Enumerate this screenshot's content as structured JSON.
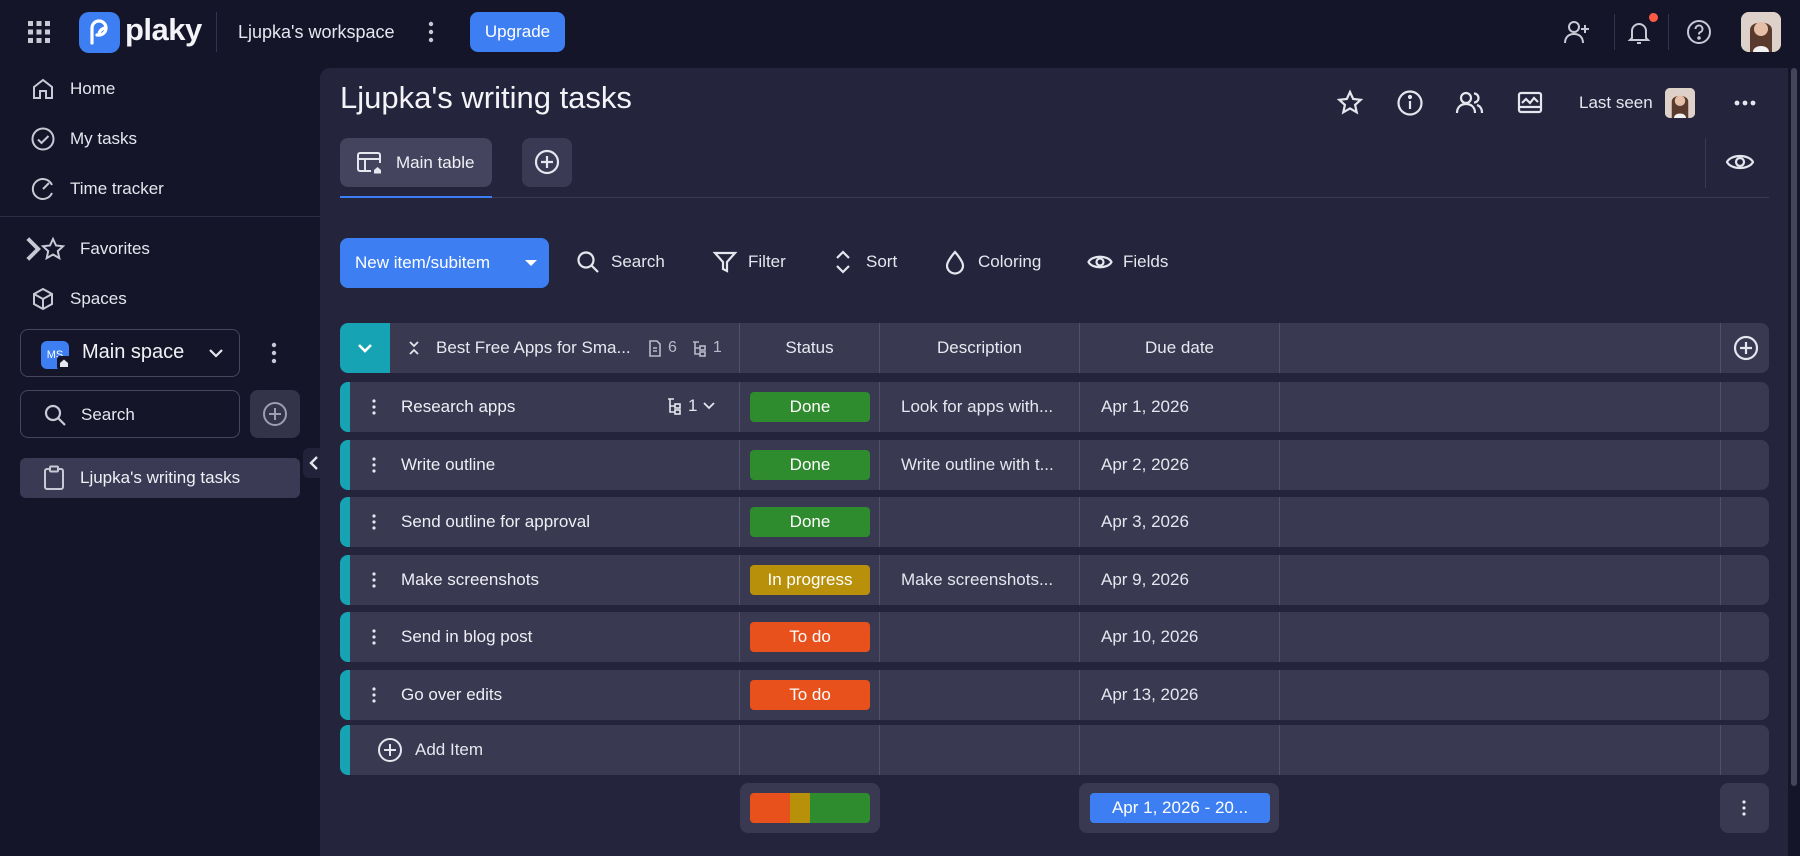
{
  "topbar": {
    "logo_text": "plaky",
    "workspace": "Ljupka's workspace",
    "upgrade_label": "Upgrade"
  },
  "sidebar": {
    "items": [
      {
        "label": "Home",
        "icon": "home-icon"
      },
      {
        "label": "My tasks",
        "icon": "check-circle-icon"
      },
      {
        "label": "Time tracker",
        "icon": "timer-icon"
      }
    ],
    "favorites_label": "Favorites",
    "spaces_label": "Spaces",
    "space": {
      "badge": "MS",
      "label": "Main space"
    },
    "search_placeholder": "Search",
    "boards": [
      {
        "label": "Ljupka's writing tasks"
      }
    ]
  },
  "header": {
    "title": "Ljupka's writing tasks",
    "last_seen_label": "Last seen",
    "view_tab_label": "Main table"
  },
  "toolbar": {
    "new_item_label": "New item/subitem",
    "search_label": "Search",
    "filter_label": "Filter",
    "sort_label": "Sort",
    "coloring_label": "Coloring",
    "fields_label": "Fields"
  },
  "table": {
    "group_name": "Best Free Apps for Sma...",
    "item_count": "6",
    "subitem_count": "1",
    "columns": {
      "status": "Status",
      "description": "Description",
      "due_date": "Due date"
    },
    "rows": [
      {
        "name": "Research apps",
        "status": "Done",
        "status_color": "#2e8b2e",
        "description": "Look for apps with...",
        "due": "Apr 1, 2026",
        "subitems": "1"
      },
      {
        "name": "Write outline",
        "status": "Done",
        "status_color": "#2e8b2e",
        "description": "Write outline with t...",
        "due": "Apr 2, 2026"
      },
      {
        "name": "Send outline for approval",
        "status": "Done",
        "status_color": "#2e8b2e",
        "description": "",
        "due": "Apr 3, 2026"
      },
      {
        "name": "Make screenshots",
        "status": "In progress",
        "status_color": "#b8900a",
        "description": "Make screenshots...",
        "due": "Apr 9, 2026"
      },
      {
        "name": "Send in blog post",
        "status": "To do",
        "status_color": "#e8501c",
        "description": "",
        "due": "Apr 10, 2026"
      },
      {
        "name": "Go over edits",
        "status": "To do",
        "status_color": "#e8501c",
        "description": "",
        "due": "Apr 13, 2026"
      }
    ],
    "add_item_label": "Add Item",
    "summary": {
      "status_breakdown": [
        {
          "status": "To do",
          "color": "#e8501c",
          "fraction": 0.333
        },
        {
          "status": "In progress",
          "color": "#b8900a",
          "fraction": 0.167
        },
        {
          "status": "Done",
          "color": "#2e8b2e",
          "fraction": 0.5
        }
      ],
      "date_range": "Apr 1, 2026 - 20..."
    }
  },
  "colors": {
    "accent": "#3d7ff2",
    "group": "#16a3b3",
    "background": "#15152a",
    "panel": "#24243c",
    "row": "#393951"
  }
}
